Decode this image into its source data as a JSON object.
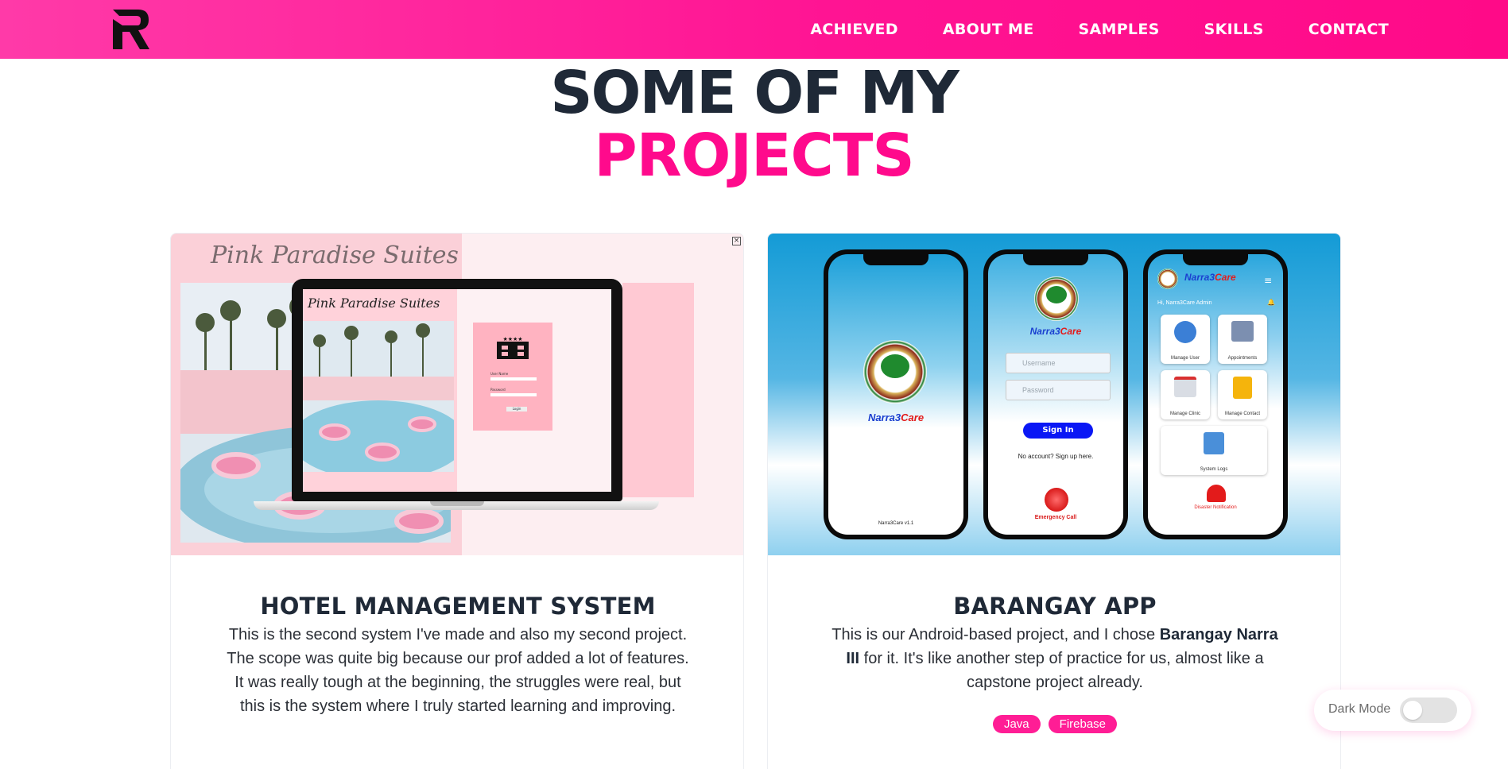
{
  "nav": {
    "logo_icon": "r-logo-icon",
    "items": [
      {
        "label": "ACHIEVED"
      },
      {
        "label": "ABOUT ME"
      },
      {
        "label": "SAMPLES"
      },
      {
        "label": "SKILLS"
      },
      {
        "label": "CONTACT"
      }
    ]
  },
  "section": {
    "title_line1": "SOME OF MY",
    "title_line2": "PROJECTS"
  },
  "projects": [
    {
      "screenshot": {
        "brand_script": "Pink Paradise Suites",
        "laptop_brand_script": "Pink Paradise Suites",
        "username_label": "User Name",
        "password_label": "Password",
        "login_label": "Login"
      },
      "title": "HOTEL MANAGEMENT SYSTEM",
      "desc": "This is the second system I've made and also my second project. The scope was quite big because our prof added a lot of features. It was really tough at the beginning, the struggles were real, but this is the system where I truly started learning and improving."
    },
    {
      "screenshot": {
        "app_name_part1": "Narra3",
        "app_name_part2": "Care",
        "version": "Narra3Care v1.1",
        "username_placeholder": "Username",
        "password_placeholder": "Password",
        "signin_label": "Sign In",
        "signup_text": "No account? Sign up here.",
        "emergency_label": "Emergency Call",
        "greeting": "Hi, Narra3Care Admin",
        "tiles": [
          "Manage User",
          "Appointments",
          "Manage Clinic",
          "Manage Contact",
          "System Logs"
        ],
        "disaster_label": "Disaster Notification"
      },
      "title": "BARANGAY APP",
      "desc_part1": "This is our Android-based project, and I chose ",
      "desc_bold": "Barangay Narra III",
      "desc_part2": " for it. It's like another step of practice for us, almost like a capstone project already.",
      "tags": [
        "Java",
        "Firebase"
      ]
    }
  ],
  "dark_mode": {
    "label": "Dark Mode",
    "enabled": false
  },
  "colors": {
    "accent": "#ff1493",
    "heading": "#1f2937"
  }
}
